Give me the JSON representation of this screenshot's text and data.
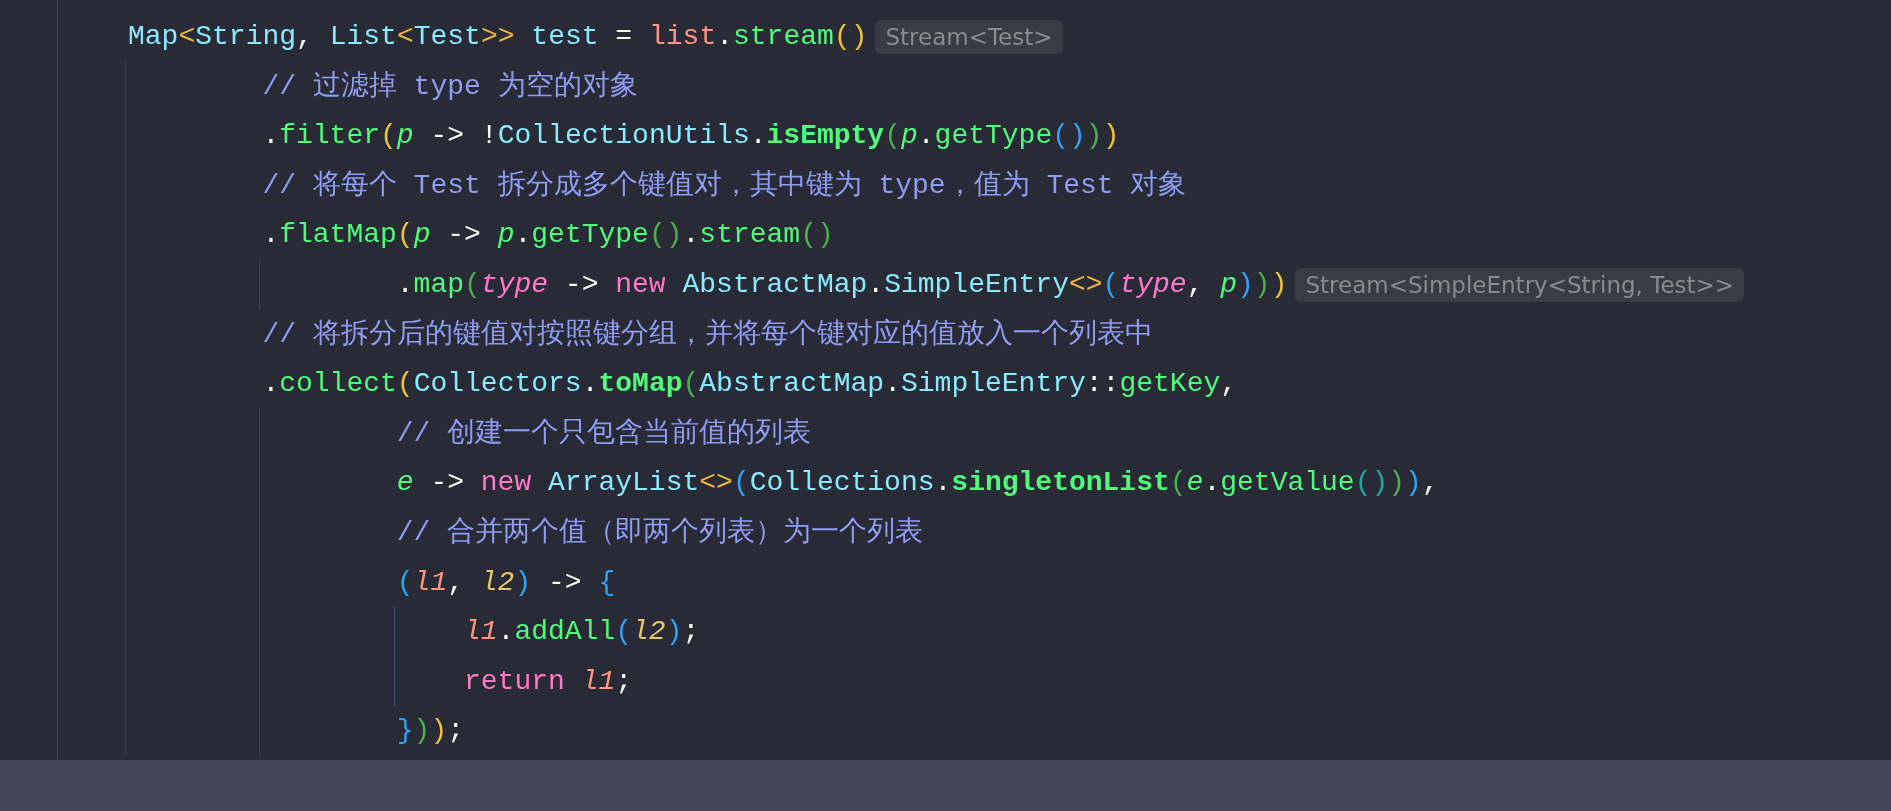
{
  "editor": {
    "lines": [
      {
        "tokens": [
          {
            "text": "Map",
            "kind": "type"
          },
          {
            "text": "<",
            "kind": "angle"
          },
          {
            "text": "String",
            "kind": "type"
          },
          {
            "text": ", ",
            "kind": "punct"
          },
          {
            "text": "List",
            "kind": "type"
          },
          {
            "text": "<",
            "kind": "angle"
          },
          {
            "text": "Test",
            "kind": "type"
          },
          {
            "text": ">>",
            "kind": "angle"
          },
          {
            "text": " test",
            "kind": "var"
          },
          {
            "text": " = ",
            "kind": "punct"
          },
          {
            "text": "list",
            "kind": "local"
          },
          {
            "text": ".",
            "kind": "punct"
          },
          {
            "text": "stream",
            "kind": "method"
          },
          {
            "text": "()",
            "kind": "paren1"
          }
        ],
        "hint": "Stream<Test>",
        "children": [
          {
            "tokens": [
              {
                "text": "// 过滤掉 type 为空的对象",
                "kind": "comment"
              }
            ]
          },
          {
            "tokens": [
              {
                "text": ".",
                "kind": "punct"
              },
              {
                "text": "filter",
                "kind": "method"
              },
              {
                "text": "(",
                "kind": "paren1"
              },
              {
                "text": "p",
                "kind": "param-green"
              },
              {
                "text": " -> !",
                "kind": "punct"
              },
              {
                "text": "CollectionUtils",
                "kind": "type"
              },
              {
                "text": ".",
                "kind": "punct"
              },
              {
                "text": "isEmpty",
                "kind": "method-bold"
              },
              {
                "text": "(",
                "kind": "paren2"
              },
              {
                "text": "p",
                "kind": "param-green"
              },
              {
                "text": ".",
                "kind": "punct"
              },
              {
                "text": "getType",
                "kind": "method"
              },
              {
                "text": "()",
                "kind": "paren3"
              },
              {
                "text": ")",
                "kind": "paren2"
              },
              {
                "text": ")",
                "kind": "paren1"
              }
            ]
          },
          {
            "tokens": [
              {
                "text": "// 将每个 Test 拆分成多个键值对，其中键为 type，值为 Test 对象",
                "kind": "comment"
              }
            ]
          },
          {
            "tokens": [
              {
                "text": ".",
                "kind": "punct"
              },
              {
                "text": "flatMap",
                "kind": "method"
              },
              {
                "text": "(",
                "kind": "paren1"
              },
              {
                "text": "p",
                "kind": "param-green"
              },
              {
                "text": " -> ",
                "kind": "punct"
              },
              {
                "text": "p",
                "kind": "param-green"
              },
              {
                "text": ".",
                "kind": "punct"
              },
              {
                "text": "getType",
                "kind": "method"
              },
              {
                "text": "()",
                "kind": "paren2"
              },
              {
                "text": ".",
                "kind": "punct"
              },
              {
                "text": "stream",
                "kind": "method"
              },
              {
                "text": "()",
                "kind": "paren2"
              }
            ],
            "children": [
              {
                "tokens": [
                  {
                    "text": ".",
                    "kind": "punct"
                  },
                  {
                    "text": "map",
                    "kind": "method"
                  },
                  {
                    "text": "(",
                    "kind": "paren2"
                  },
                  {
                    "text": "type",
                    "kind": "param-pink"
                  },
                  {
                    "text": " -> ",
                    "kind": "punct"
                  },
                  {
                    "text": "new ",
                    "kind": "keyword"
                  },
                  {
                    "text": "AbstractMap",
                    "kind": "type"
                  },
                  {
                    "text": ".",
                    "kind": "punct"
                  },
                  {
                    "text": "SimpleEntry",
                    "kind": "type"
                  },
                  {
                    "text": "<>",
                    "kind": "angle"
                  },
                  {
                    "text": "(",
                    "kind": "paren3"
                  },
                  {
                    "text": "type",
                    "kind": "param-pink"
                  },
                  {
                    "text": ", ",
                    "kind": "punct"
                  },
                  {
                    "text": "p",
                    "kind": "param-green"
                  },
                  {
                    "text": ")",
                    "kind": "paren3"
                  },
                  {
                    "text": ")",
                    "kind": "paren2"
                  },
                  {
                    "text": ")",
                    "kind": "paren1"
                  }
                ],
                "hint": "Stream<SimpleEntry<String, Test>>"
              }
            ]
          },
          {
            "tokens": [
              {
                "text": "// 将拆分后的键值对按照键分组，并将每个键对应的值放入一个列表中",
                "kind": "comment"
              }
            ]
          },
          {
            "tokens": [
              {
                "text": ".",
                "kind": "punct"
              },
              {
                "text": "collect",
                "kind": "method"
              },
              {
                "text": "(",
                "kind": "paren1"
              },
              {
                "text": "Collectors",
                "kind": "type"
              },
              {
                "text": ".",
                "kind": "punct"
              },
              {
                "text": "toMap",
                "kind": "method-bold"
              },
              {
                "text": "(",
                "kind": "paren2"
              },
              {
                "text": "AbstractMap",
                "kind": "type"
              },
              {
                "text": ".",
                "kind": "punct"
              },
              {
                "text": "SimpleEntry",
                "kind": "type"
              },
              {
                "text": "::",
                "kind": "punct"
              },
              {
                "text": "getKey",
                "kind": "method"
              },
              {
                "text": ",",
                "kind": "punct"
              }
            ],
            "children": [
              {
                "tokens": [
                  {
                    "text": "// 创建一个只包含当前值的列表",
                    "kind": "comment"
                  }
                ]
              },
              {
                "tokens": [
                  {
                    "text": "e",
                    "kind": "param-green"
                  },
                  {
                    "text": " -> ",
                    "kind": "punct"
                  },
                  {
                    "text": "new ",
                    "kind": "keyword"
                  },
                  {
                    "text": "ArrayList",
                    "kind": "type"
                  },
                  {
                    "text": "<>",
                    "kind": "angle"
                  },
                  {
                    "text": "(",
                    "kind": "paren3"
                  },
                  {
                    "text": "Collections",
                    "kind": "type"
                  },
                  {
                    "text": ".",
                    "kind": "punct"
                  },
                  {
                    "text": "singletonList",
                    "kind": "method-bold"
                  },
                  {
                    "text": "(",
                    "kind": "paren2"
                  },
                  {
                    "text": "e",
                    "kind": "param-green"
                  },
                  {
                    "text": ".",
                    "kind": "punct"
                  },
                  {
                    "text": "getValue",
                    "kind": "method"
                  },
                  {
                    "text": "()",
                    "kind": "paren4"
                  },
                  {
                    "text": ")",
                    "kind": "paren2"
                  },
                  {
                    "text": ")",
                    "kind": "paren3"
                  },
                  {
                    "text": ",",
                    "kind": "punct"
                  }
                ]
              },
              {
                "tokens": [
                  {
                    "text": "// 合并两个值（即两个列表）为一个列表",
                    "kind": "comment"
                  }
                ]
              },
              {
                "tokens": [
                  {
                    "text": "(",
                    "kind": "paren3"
                  },
                  {
                    "text": "l1",
                    "kind": "param-salmon"
                  },
                  {
                    "text": ", ",
                    "kind": "punct"
                  },
                  {
                    "text": "l2",
                    "kind": "param-yellow"
                  },
                  {
                    "text": ")",
                    "kind": "paren3"
                  },
                  {
                    "text": " -> ",
                    "kind": "punct"
                  },
                  {
                    "text": "{",
                    "kind": "paren3"
                  }
                ],
                "children": [
                  {
                    "tokens": [
                      {
                        "text": "l1",
                        "kind": "param-salmon"
                      },
                      {
                        "text": ".",
                        "kind": "punct"
                      },
                      {
                        "text": "addAll",
                        "kind": "method"
                      },
                      {
                        "text": "(",
                        "kind": "paren3"
                      },
                      {
                        "text": "l2",
                        "kind": "param-yellow"
                      },
                      {
                        "text": ")",
                        "kind": "paren3"
                      },
                      {
                        "text": ";",
                        "kind": "punct"
                      }
                    ]
                  },
                  {
                    "tokens": [
                      {
                        "text": "return ",
                        "kind": "keyword"
                      },
                      {
                        "text": "l1",
                        "kind": "param-salmon"
                      },
                      {
                        "text": ";",
                        "kind": "punct"
                      }
                    ]
                  }
                ]
              },
              {
                "tokens": [
                  {
                    "text": "}",
                    "kind": "paren3"
                  },
                  {
                    "text": ")",
                    "kind": "paren2"
                  },
                  {
                    "text": ")",
                    "kind": "paren1"
                  },
                  {
                    "text": ";",
                    "kind": "punct"
                  }
                ]
              }
            ]
          }
        ]
      }
    ]
  }
}
